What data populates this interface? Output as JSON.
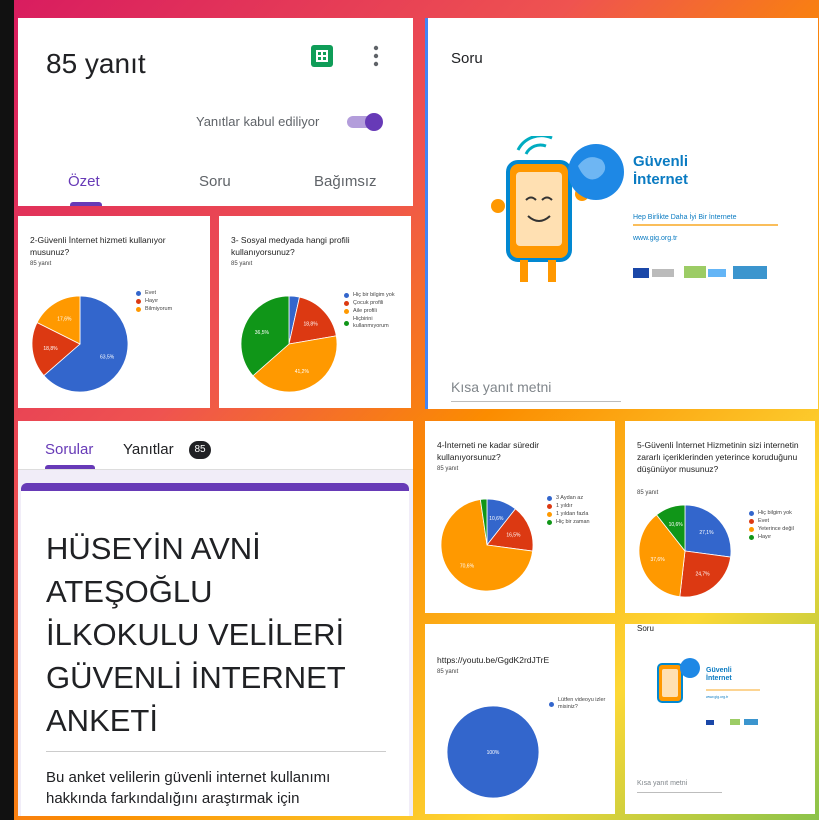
{
  "colors": {
    "blue": "#3366cc",
    "red": "#dc3912",
    "orange": "#ff9900",
    "green": "#109618",
    "purple": "#673ab7",
    "frame_red": "#e53935",
    "frame_orange": "#fb8c00",
    "frame_yellow": "#fbc02d",
    "frame_green": "#7cb342"
  },
  "responses": {
    "title": "85 yanıt",
    "accepting_label": "Yanıtlar kabul ediliyor",
    "tabs": [
      "Özet",
      "Soru",
      "Bağımsız"
    ]
  },
  "question_preview_top": {
    "label": "Soru",
    "short_answer_placeholder": "Kısa yanıt metni",
    "banner": {
      "title_line1": "Güvenli",
      "title_line2": "İnternet",
      "slogan": "Hep Birlikte Daha İyi Bir İnternete",
      "url": "www.gig.org.tr"
    }
  },
  "question_preview_small": {
    "label": "Soru",
    "short_answer_placeholder": "Kısa yanıt metni",
    "banner": {
      "title_line1": "Güvenli",
      "title_line2": "İnternet",
      "url": "www.gig.org.tr"
    }
  },
  "form": {
    "tabs": [
      "Sorular",
      "Yanıtlar"
    ],
    "badge": "85",
    "title_lines": [
      "HÜSEYİN AVNİ",
      "ATEŞOĞLU",
      "İLKOKULU VELİLERİ",
      "GÜVENLİ İNTERNET",
      "ANKETİ"
    ],
    "description_lines": [
      "Bu anket velilerin güvenli internet kullanımı",
      "hakkında farkındalığını araştırmak için"
    ]
  },
  "chart_data": [
    {
      "type": "pie",
      "title": "2-Güvenli İnternet hizmeti kullanıyor musunuz?",
      "count": "85 yanıt",
      "series": [
        {
          "name": "Evet",
          "value": 63.5,
          "color": "#3366cc",
          "label": "63,5%"
        },
        {
          "name": "Hayır",
          "value": 18.8,
          "color": "#dc3912",
          "label": "18,8%"
        },
        {
          "name": "Bilmiyorum",
          "value": 17.6,
          "color": "#ff9900",
          "label": "17,6%"
        }
      ]
    },
    {
      "type": "pie",
      "title": "3- Sosyal medyada hangi profili kullanıyorsunuz?",
      "count": "85 yanıt",
      "series": [
        {
          "name": "Hiç bir bilgim yok",
          "value": 3.5,
          "color": "#3366cc",
          "label": ""
        },
        {
          "name": "Çocuk profili",
          "value": 18.8,
          "color": "#dc3912",
          "label": "18,8%"
        },
        {
          "name": "Aile profili",
          "value": 41.2,
          "color": "#ff9900",
          "label": "41,2%"
        },
        {
          "name": "Hiçbirini kullanmıyorum",
          "value": 36.5,
          "color": "#109618",
          "label": "36,5%"
        }
      ]
    },
    {
      "type": "pie",
      "title": "4-İnterneti ne kadar süredir kullanıyorsunuz?",
      "count": "85 yanıt",
      "series": [
        {
          "name": "3 Aydan az",
          "value": 10.6,
          "color": "#3366cc",
          "label": "10,6%"
        },
        {
          "name": "1 yıldır",
          "value": 16.5,
          "color": "#dc3912",
          "label": "16,5%"
        },
        {
          "name": "1 yıldan fazla",
          "value": 70.6,
          "color": "#ff9900",
          "label": "70,6%"
        },
        {
          "name": "Hiç bir zaman",
          "value": 2.3,
          "color": "#109618",
          "label": ""
        }
      ]
    },
    {
      "type": "pie",
      "title": "5-Güvenli İnternet Hizmetinin sizi internetin zararlı içeriklerinden yeterince koruduğunu düşünüyor musunuz?",
      "count": "85 yanıt",
      "series": [
        {
          "name": "Hiç bilgim yok",
          "value": 27.1,
          "color": "#3366cc",
          "label": "27,1%"
        },
        {
          "name": "Evet",
          "value": 24.7,
          "color": "#dc3912",
          "label": "24,7%"
        },
        {
          "name": "Yeterince değil",
          "value": 37.6,
          "color": "#ff9900",
          "label": "37,6%"
        },
        {
          "name": "Hayır",
          "value": 10.6,
          "color": "#109618",
          "label": "10,6%"
        }
      ]
    },
    {
      "type": "pie",
      "title": "https://youtu.be/GgdK2rdJTrE",
      "count": "85 yanıt",
      "series": [
        {
          "name": "Lütfen videoyu izler misiniz?",
          "value": 100,
          "color": "#3366cc",
          "label": "100%"
        }
      ]
    }
  ]
}
